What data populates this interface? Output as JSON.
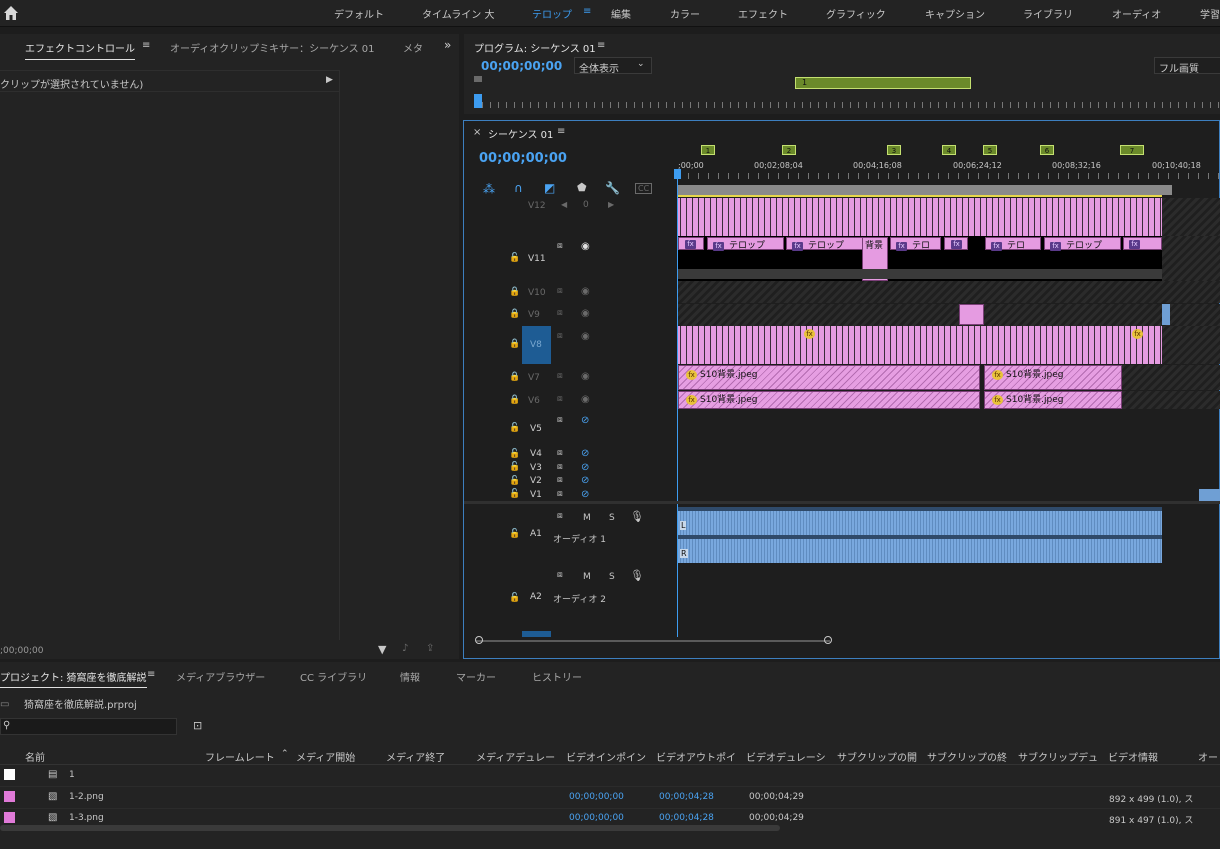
{
  "workspaces": [
    "デフォルト",
    "タイムライン 大",
    "テロップ",
    "編集",
    "カラー",
    "エフェクト",
    "グラフィック",
    "キャプション",
    "ライブラリ",
    "オーディオ",
    "学習"
  ],
  "active_workspace": "テロップ",
  "source_panel": {
    "tabs": [
      "エフェクトコントロール",
      "オーディオクリップミキサー：シーケンス 01",
      "メタ"
    ],
    "no_clip": "クリップが選択されていません)",
    "timecode": ";00;00;00"
  },
  "program": {
    "title": "プログラム: シーケンス 01",
    "timecode": "00;00;00;00",
    "fit": "全体表示",
    "quality": "フル画質",
    "marker_label": "1"
  },
  "sequence": {
    "title": "シーケンス 01",
    "timecode": "00;00;00;00",
    "ruler": [
      ";00;00",
      "00;02;08;04",
      "00;04;16;08",
      "00;06;24;12",
      "00;08;32;16",
      "00;10;40;18"
    ],
    "markers": [
      "1",
      "2",
      "3",
      "4",
      "5",
      "6",
      "7"
    ],
    "tracks": {
      "v12": "V12",
      "v11": "V11",
      "v10": "V10",
      "v9": "V9",
      "v8": "V8",
      "v7": "V7",
      "v6": "V6",
      "v5": "V5",
      "v4": "V4",
      "v3": "V3",
      "v2": "V2",
      "v1": "V1",
      "a1": "A1",
      "a2": "A2"
    },
    "audio_names": {
      "a1": "オーディオ 1",
      "a2": "オーディオ 2"
    },
    "msl": {
      "m": "M",
      "s": "S"
    },
    "v11_clips": [
      "テロップ",
      "テロップ",
      "背景",
      "テロ",
      "テロ",
      "テロップ"
    ],
    "clip_s10": "S10背景.jpeg",
    "v12_zero": "0",
    "lr": {
      "l": "L",
      "r": "R"
    }
  },
  "project": {
    "tabs": [
      "プロジェクト: 猗窩座を徹底解説",
      "メディアブラウザー",
      "CC ライブラリ",
      "情報",
      "マーカー",
      "ヒストリー"
    ],
    "file": "猗窩座を徹底解説.prproj",
    "columns": [
      "名前",
      "フレームレート",
      "メディア開始",
      "メディア終了",
      "メディアデュレー",
      "ビデオインポイン",
      "ビデオアウトポイ",
      "ビデオデュレーシ",
      "サブクリップの開",
      "サブクリップの終",
      "サブクリップデュ",
      "ビデオ情報",
      "オー"
    ],
    "rows": [
      {
        "name": "1",
        "in": "",
        "out": "",
        "dur": "",
        "info": "",
        "color": "#ffffff"
      },
      {
        "name": "1-2.png",
        "in": "00;00;00;00",
        "out": "00;00;04;28",
        "dur": "00;00;04;29",
        "info": "892 x 499 (1.0), ス",
        "color": "#e07ad8"
      },
      {
        "name": "1-3.png",
        "in": "00;00;00;00",
        "out": "00;00;04;28",
        "dur": "00;00;04;29",
        "info": "891 x 497 (1.0), ス",
        "color": "#e07ad8"
      }
    ]
  },
  "colors": {
    "accent": "#3d9cf0",
    "clip_pink": "#e59be1",
    "audio_clip": "#6f9fd4",
    "marker": "#6b8a2a"
  }
}
